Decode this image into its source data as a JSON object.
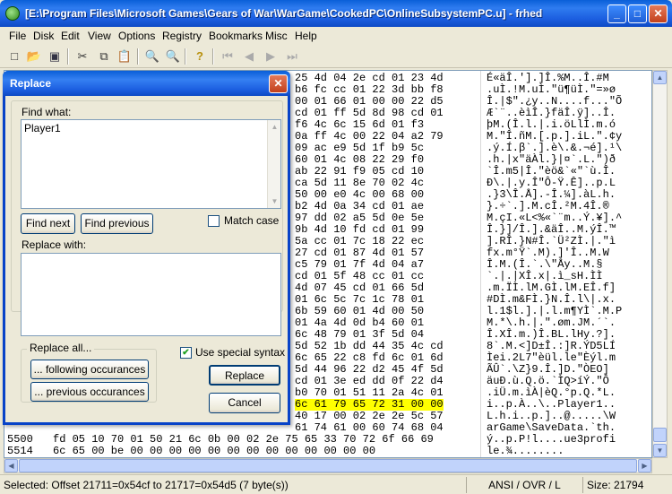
{
  "window": {
    "title": "[E:\\Program Files\\Microsoft Games\\Gears of War\\WarGame\\CookedPC\\OnlineSubsystemPC.u] - frhed",
    "minimize": "_",
    "maximize": "□",
    "close": "✕"
  },
  "menu": [
    "File",
    "Disk",
    "Edit",
    "View",
    "Options",
    "Registry",
    "Bookmarks",
    "Misc",
    "Help"
  ],
  "toolbar_icons": [
    "new-icon",
    "open-icon",
    "save-icon",
    "cut-icon",
    "copy-icon",
    "paste-icon",
    "find-icon",
    "replace-icon",
    "help-icon",
    "first-icon",
    "prev-icon",
    "next-icon",
    "last-icon"
  ],
  "hex_rows": [
    {
      "off": "",
      "hex": "25 4d 04 2e cd 01 23 4d",
      "asc": "É«äÎ.'].]Î.%M..Î.#M"
    },
    {
      "off": "",
      "hex": "b6 fc cc 01 22 3d bb f8",
      "asc": ".uÌ.!M.uÌ.\"ü¶üÌ.\"=»ø"
    },
    {
      "off": "",
      "hex": "00 01 66 01 00 00 22 d5",
      "asc": "Î.|$\".¿y..N....f...\"Õ"
    },
    {
      "off": "",
      "hex": "cd 01 ff 5d 8d 98 cd 01",
      "asc": "Æ`¨..èìÎ.}fäÎ.ÿ]..Î."
    },
    {
      "off": "",
      "hex": "f6 4c 6c 15 6d 01 f3",
      "asc": "þM.(Î.l.|.i.öLlÌ.m.ó"
    },
    {
      "off": "",
      "hex": "0a ff 4c 00 22 04 a2 79",
      "asc": "M.\"Î.ñM.[.p.].iL.\".¢y"
    },
    {
      "off": "",
      "hex": "09 ac e9 5d 1f b9 5c",
      "asc": ".ý.Í.β`.].è\\.&.¬é].¹\\"
    },
    {
      "off": "",
      "hex": "60 01 4c 08 22 29 f0",
      "asc": ".h.|x\"äÀl.}|¤`.L.\")ð"
    },
    {
      "off": "",
      "hex": "ab 22 91 f9 05 cd 10",
      "asc": "`Î.m5|Î.\"èö&`«\"`ù.Î."
    },
    {
      "off": "",
      "hex": "ca 5d 11 8e 70 02 4c",
      "asc": "Ð\\.|.y.Î\"Ô-Ÿ.Ê]..p.L"
    },
    {
      "off": "",
      "hex": "50 00 e0 4c 00 68 00",
      "asc": ".}3\\Î.Å].-Î.¼].àL.h."
    },
    {
      "off": "",
      "hex": "b2 4d 0a 34 cd 01 ae",
      "asc": "}.÷`.].M.cÎ.²M.4Î.®"
    },
    {
      "off": "",
      "hex": "97 dd 02 a5 5d 0e 5e",
      "asc": "M.çI.«L<%«`¨m..Ý.¥].^"
    },
    {
      "off": "",
      "hex": "9b 4d 10 fd cd 01 99",
      "asc": "Î.}]/Î.].&äÎ..M.ýÎ.™"
    },
    {
      "off": "",
      "hex": "5a cc 01 7c 18 22 ec",
      "asc": "].RÎ.}N#Î.`Ü²ZÌ.|.\"ì"
    },
    {
      "off": "",
      "hex": "27 cd 01 87 4d 01 57",
      "asc": "fx.m°Ÿ`.M).]'Î..M.W"
    },
    {
      "off": "",
      "hex": "c5 79 01 7f 4d 04 a7",
      "asc": "Î.M.(Î.`.\\\"Åy..M.§"
    },
    {
      "off": "",
      "hex": "cd 01 5f 48 cc 01 cc",
      "asc": "`.|.|XÎ.x|.ì_sH.ÌÌ"
    },
    {
      "off": "",
      "hex": "4d 07 45 cd 01 66 5d",
      "asc": ".m.ÏÌ.lM.GÌ.lM.EÎ.f]"
    },
    {
      "off": "",
      "hex": "01 6c 5c 7c 1c 78 01",
      "asc": "#DÌ.m&FÌ.}N.Î.l\\|.x."
    },
    {
      "off": "",
      "hex": "6b 59 60 01 4d 00 50",
      "asc": "l.1$l.].|.l.m¶YÌ`.M.P"
    },
    {
      "off": "",
      "hex": "01 4a 4d 0d b4 60 01",
      "asc": "M.*\\.h.|.\".øm.JM.´`."
    },
    {
      "off": "",
      "hex": "6c 48 79 01 3f 5d 04",
      "asc": "Î.XÎ.m.)Î.BL.lHy.?]."
    },
    {
      "off": "",
      "hex": "5d 52 1b dd 44 35 4c cd",
      "asc": "8`.M.<]D±Î.:]R.ÝD5LÍ"
    },
    {
      "off": "",
      "hex": "6c 65 22 c8 fd 6c 01 6d",
      "asc": "Ìei.2L7\"èül.le\"Èýl.m"
    },
    {
      "off": "",
      "hex": "5d 44 96 22 d2 45 4f 5d",
      "asc": "ÃÛ`.\\Z}9.Î.]D.\"ÒEO]"
    },
    {
      "off": "",
      "hex": "cd 01 3e ed dd 0f 22 d4",
      "asc": "äuÐ.ù.Q.ö.`ÌQ>íÝ.\"Ô"
    },
    {
      "off": "",
      "hex": "b0 70 01 51 11 2a 4c 01",
      "asc": ".iÜ.m.ìÀ|èQ.°p.Q.*L."
    },
    {
      "off": "",
      "hex": "6c 61 79 65 72 31 00 00",
      "asc": "i..p.À..\\..Player1..",
      "hl": true
    },
    {
      "off": "",
      "hex": "40 17 00 02 2e 2e 5c 57",
      "asc": "L.h.i..p.]..@.....\\W"
    },
    {
      "off": "",
      "hex": "61 74 61 00 60 74 68 04",
      "asc": "arGame\\SaveData.`th."
    },
    {
      "off": "5500",
      "hex": "fd 05 10 70 01 50 21 6c 0b 00 02 2e 75 65 33 70 72 6f 66 69",
      "asc": "ý..p.P!l....ue3profi"
    },
    {
      "off": "5514",
      "hex": "6c 65 00 be 00 00 00 00 00 00 00 00 00 00 00 00 00",
      "asc": "le.¾........"
    }
  ],
  "status": {
    "selection": "Selected: Offset 21711=0x54cf to 21717=0x54d5 (7 byte(s))",
    "mode": "ANSI / OVR / L",
    "size": "Size: 21794"
  },
  "dialog": {
    "title": "Replace",
    "close": "✕",
    "find_what_label": "Find what:",
    "find_what_value": "Player1",
    "find_next": "Find next",
    "find_previous": "Find previous",
    "match_case_label": "Match case",
    "match_case_checked": false,
    "replace_with_label": "Replace with:",
    "replace_with_value": "",
    "replace_all_label": "Replace all...",
    "following_btn": "... following occurances",
    "previous_btn": "... previous occurances",
    "use_special_syntax_label": "Use special syntax",
    "use_special_syntax_checked": true,
    "replace_btn": "Replace",
    "cancel_btn": "Cancel"
  }
}
